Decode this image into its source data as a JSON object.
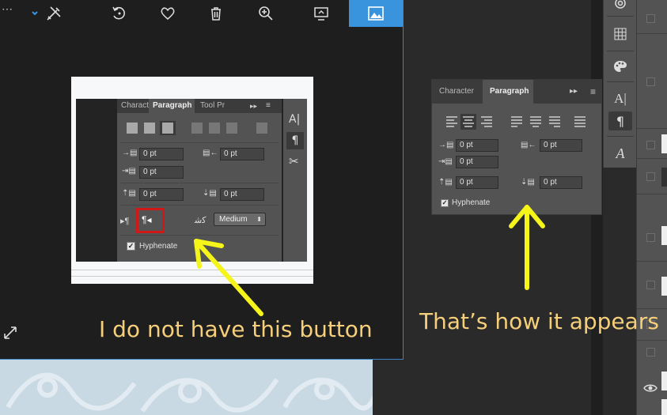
{
  "viewer": {
    "toolbar": {
      "more": "⋯",
      "active_icon": "photo-icon"
    },
    "embedded_panel": {
      "tabs": [
        "Charact",
        "Paragraph",
        "Tool Pr"
      ],
      "active_tab": "Paragraph",
      "overflow": "▸▸",
      "fields": {
        "indent_left": "0 pt",
        "indent_right": "0 pt",
        "indent_first": "0 pt",
        "space_before": "0 pt",
        "space_after": "0 pt"
      },
      "dropdown_value": "Medium",
      "hyphenate_label": "Hyphenate"
    }
  },
  "paragraph_panel": {
    "tabs": [
      "Character",
      "Paragraph"
    ],
    "active_tab": "Paragraph",
    "overflow": "▸▸",
    "fields": {
      "indent_left": "0 pt",
      "indent_right": "0 pt",
      "indent_first": "0 pt",
      "space_before": "0 pt",
      "space_after": "0 pt"
    },
    "hyphenate_label": "Hyphenate",
    "hyphenate_checked": true
  },
  "annotations": {
    "left": "I do not have this button",
    "right": "That’s how it appears",
    "arrow_color": "#f5f51a",
    "highlight_color": "#d01818"
  },
  "colors": {
    "accent": "#3a93dd",
    "panel": "#535353",
    "caption": "#f5cf7a"
  }
}
